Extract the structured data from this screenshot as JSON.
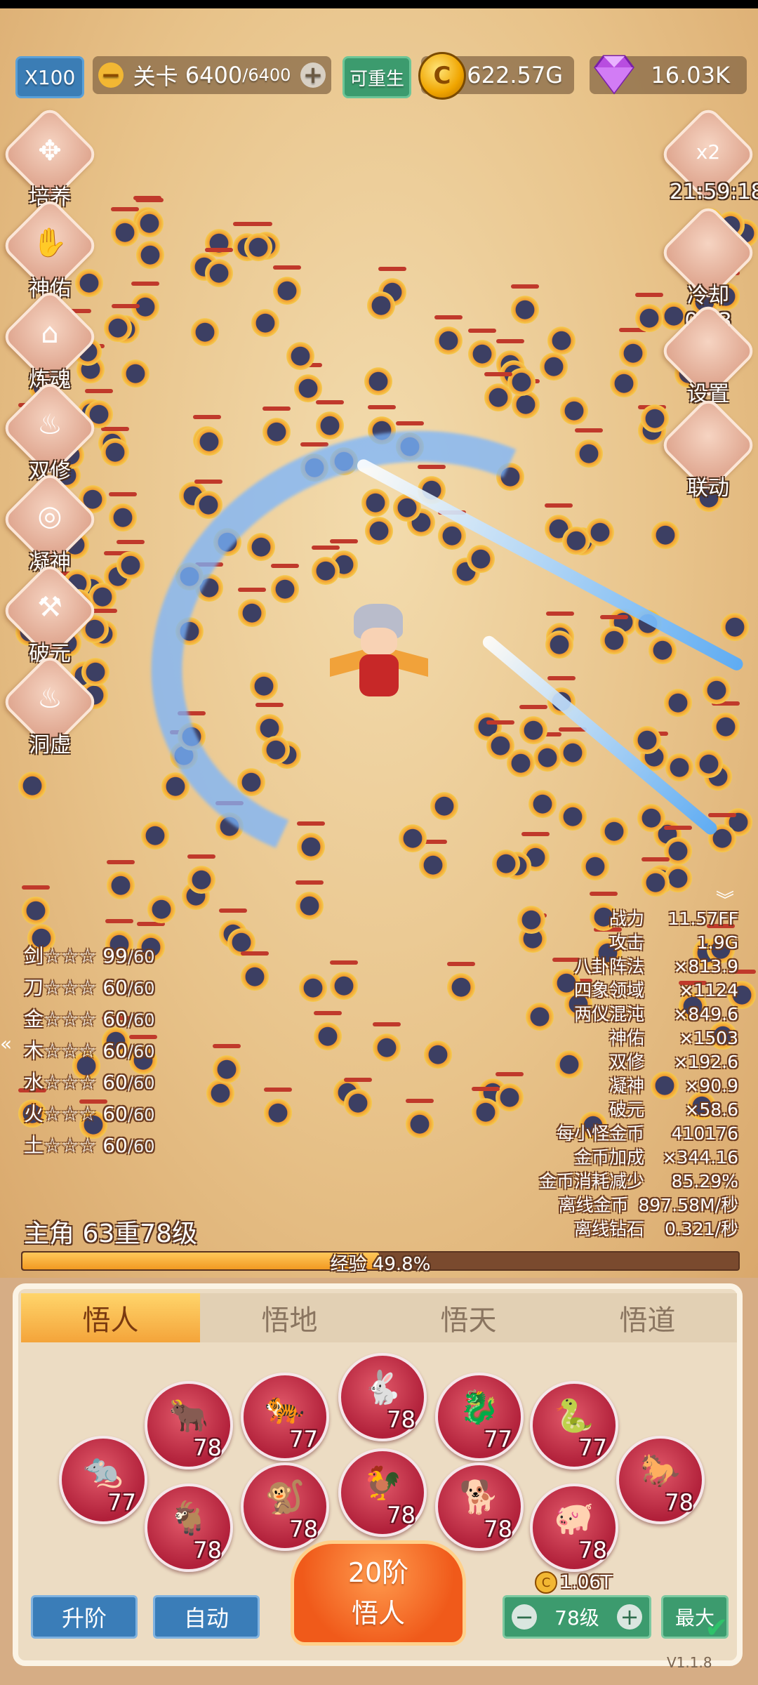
{
  "top": {
    "speed": "X100",
    "stage_label": "关卡",
    "stage_current": "6400",
    "stage_max": "6400",
    "stage_sep": "/",
    "minus": "−",
    "plus": "+",
    "rebirth": "可重生",
    "gold": "622.57G",
    "gold_coin_glyph": "C",
    "diamond": "16.03K"
  },
  "left_menu": [
    {
      "label": "培养",
      "icon": "cultivate-icon",
      "glyph": "✥"
    },
    {
      "label": "神佑",
      "icon": "blessing-hands-icon",
      "glyph": "✋"
    },
    {
      "label": "炼魂",
      "icon": "soul-refine-icon",
      "glyph": "⌂"
    },
    {
      "label": "双修",
      "icon": "dual-cultivation-icon",
      "glyph": "♨"
    },
    {
      "label": "凝神",
      "icon": "focus-icon",
      "glyph": "◎"
    },
    {
      "label": "破元",
      "icon": "hammer-icon",
      "glyph": "⚒"
    },
    {
      "label": "洞虚",
      "icon": "flame-icon",
      "glyph": "♨"
    }
  ],
  "right_menu": [
    {
      "label": "21:59:18",
      "badge": "x2",
      "icon": "money-bag-icon"
    },
    {
      "label": "冷却 0:43",
      "badge": "",
      "icon": "diamond-gift-icon"
    },
    {
      "label": "设置",
      "badge": "",
      "icon": "gear-icon"
    },
    {
      "label": "联动",
      "badge": "",
      "icon": "link-icon"
    }
  ],
  "weapon_stats": [
    {
      "name": "剑",
      "stars": "☆☆☆",
      "value": "99",
      "max": "60"
    },
    {
      "name": "刀",
      "stars": "☆☆☆",
      "value": "60",
      "max": "60"
    },
    {
      "name": "金",
      "stars": "☆☆☆",
      "value": "60",
      "max": "60"
    },
    {
      "name": "木",
      "stars": "☆☆☆",
      "value": "60",
      "max": "60"
    },
    {
      "name": "水",
      "stars": "☆☆☆",
      "value": "60",
      "max": "60"
    },
    {
      "name": "火",
      "stars": "☆☆☆",
      "value": "60",
      "max": "60"
    },
    {
      "name": "土",
      "stars": "☆☆☆",
      "value": "60",
      "max": "60"
    }
  ],
  "power_stats": [
    {
      "label": "战力",
      "value": "11.57FF"
    },
    {
      "label": "攻击",
      "value": "1.9G"
    },
    {
      "label": "八卦阵法",
      "value": "×813.9"
    },
    {
      "label": "四象领域",
      "value": "×1124"
    },
    {
      "label": "两仪混沌",
      "value": "×849.6"
    },
    {
      "label": "神佑",
      "value": "×1503"
    },
    {
      "label": "双修",
      "value": "×192.6"
    },
    {
      "label": "凝神",
      "value": "×90.9"
    },
    {
      "label": "破元",
      "value": "×58.6"
    },
    {
      "label": "每小怪金币",
      "value": "410176"
    },
    {
      "label": "金币加成",
      "value": "×344.16"
    },
    {
      "label": "金币消耗减少",
      "value": "85.29%"
    },
    {
      "label": "离线金币",
      "value": "897.58M/秒"
    },
    {
      "label": "离线钻石",
      "value": "0.321/秒"
    }
  ],
  "hero": {
    "level_text": "主角 63重78级",
    "xp_text": "经验 49.8%",
    "xp_progress": 0.498
  },
  "tabs": [
    "悟人",
    "悟地",
    "悟天",
    "悟道"
  ],
  "active_tab": 0,
  "zodiac": [
    {
      "icon": "rat-icon",
      "glyph": "🐀",
      "level": "77"
    },
    {
      "icon": "ox-icon",
      "glyph": "🐂",
      "level": "78"
    },
    {
      "icon": "goat-icon",
      "glyph": "🐐",
      "level": "78"
    },
    {
      "icon": "tiger-icon",
      "glyph": "🐅",
      "level": "77"
    },
    {
      "icon": "monkey-icon",
      "glyph": "🐒",
      "level": "78"
    },
    {
      "icon": "rabbit-icon",
      "glyph": "🐇",
      "level": "78"
    },
    {
      "icon": "rooster-icon",
      "glyph": "🐓",
      "level": "78"
    },
    {
      "icon": "dragon-icon",
      "glyph": "🐉",
      "level": "77"
    },
    {
      "icon": "dog-icon",
      "glyph": "🐕",
      "level": "78"
    },
    {
      "icon": "snake-icon",
      "glyph": "🐍",
      "level": "77"
    },
    {
      "icon": "pig-icon",
      "glyph": "🐖",
      "level": "78"
    },
    {
      "icon": "horse-icon",
      "glyph": "🐎",
      "level": "78"
    }
  ],
  "bottom": {
    "upgrade": "升阶",
    "auto": "自动",
    "stage_line1": "20阶",
    "stage_line2": "悟人",
    "cost": "1.06T",
    "cost_coin_glyph": "C",
    "level": "78级",
    "minus": "−",
    "plus": "+",
    "max": "最大",
    "version": "V1.1.8"
  },
  "ui_glyphs": {
    "collapse": "︾",
    "left_arrow": "«"
  },
  "colors": {
    "sand": "#e8c38a",
    "accent_orange": "#f29a22",
    "button_blue": "#3a7db8",
    "button_green": "#3c9b6e",
    "zodiac_red": "#b1203a"
  }
}
